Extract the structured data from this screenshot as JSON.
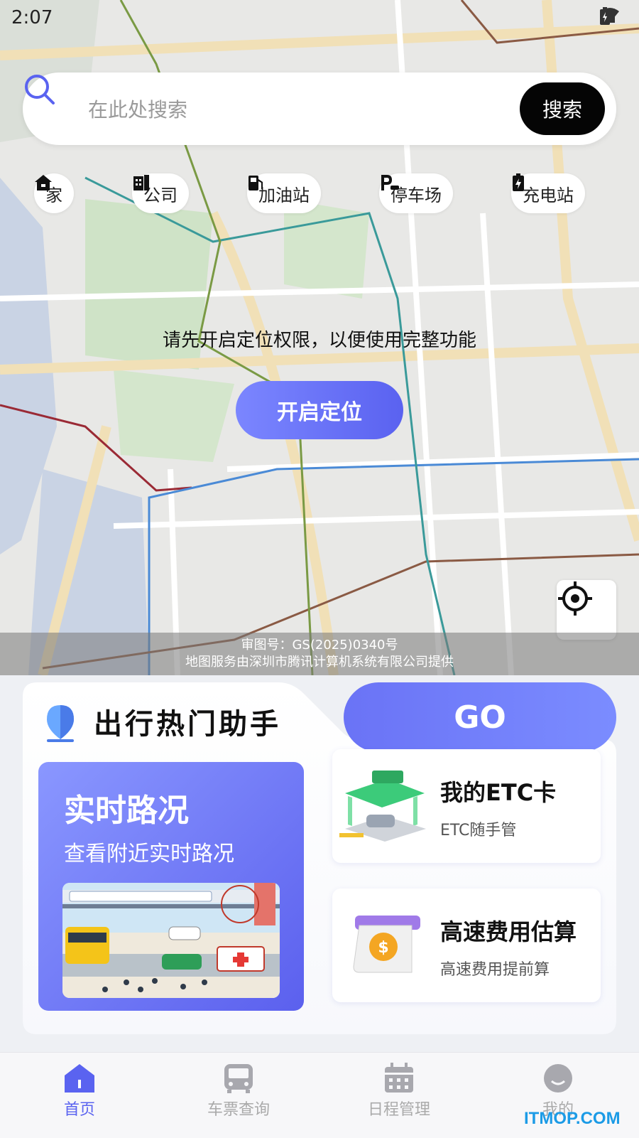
{
  "status_bar": {
    "time": "2:07"
  },
  "search": {
    "placeholder": "在此处搜索",
    "button_label": "搜索"
  },
  "chips": [
    {
      "label": "家",
      "icon": "home-icon"
    },
    {
      "label": "公司",
      "icon": "building-icon"
    },
    {
      "label": "加油站",
      "icon": "gas-station-icon"
    },
    {
      "label": "停车场",
      "icon": "parking-icon"
    },
    {
      "label": "充电站",
      "icon": "charging-station-icon"
    }
  ],
  "map": {
    "permission_text": "请先开启定位权限，以便使用完整功能",
    "enable_location_label": "开启定位",
    "credit_line1": "审图号：GS(2025)0340号",
    "credit_line2": "地图服务由深圳市腾讯计算机系统有限公司提供"
  },
  "assistant": {
    "title": "出行热门助手",
    "go_label": "GO",
    "traffic_card": {
      "title": "实时路况",
      "subtitle": "查看附近实时路况"
    },
    "etc_card": {
      "title": "我的ETC卡",
      "subtitle": "ETC随手管"
    },
    "toll_card": {
      "title": "高速费用估算",
      "subtitle": "高速费用提前算"
    }
  },
  "tabs": [
    {
      "label": "首页",
      "icon": "home-tab-icon",
      "active": true
    },
    {
      "label": "车票查询",
      "icon": "bus-icon",
      "active": false
    },
    {
      "label": "日程管理",
      "icon": "calendar-icon",
      "active": false
    },
    {
      "label": "我的",
      "icon": "profile-icon",
      "active": false
    }
  ],
  "watermark": "ITMOP.COM",
  "colors": {
    "accent": "#5a63f0",
    "search_button": "#050505"
  }
}
